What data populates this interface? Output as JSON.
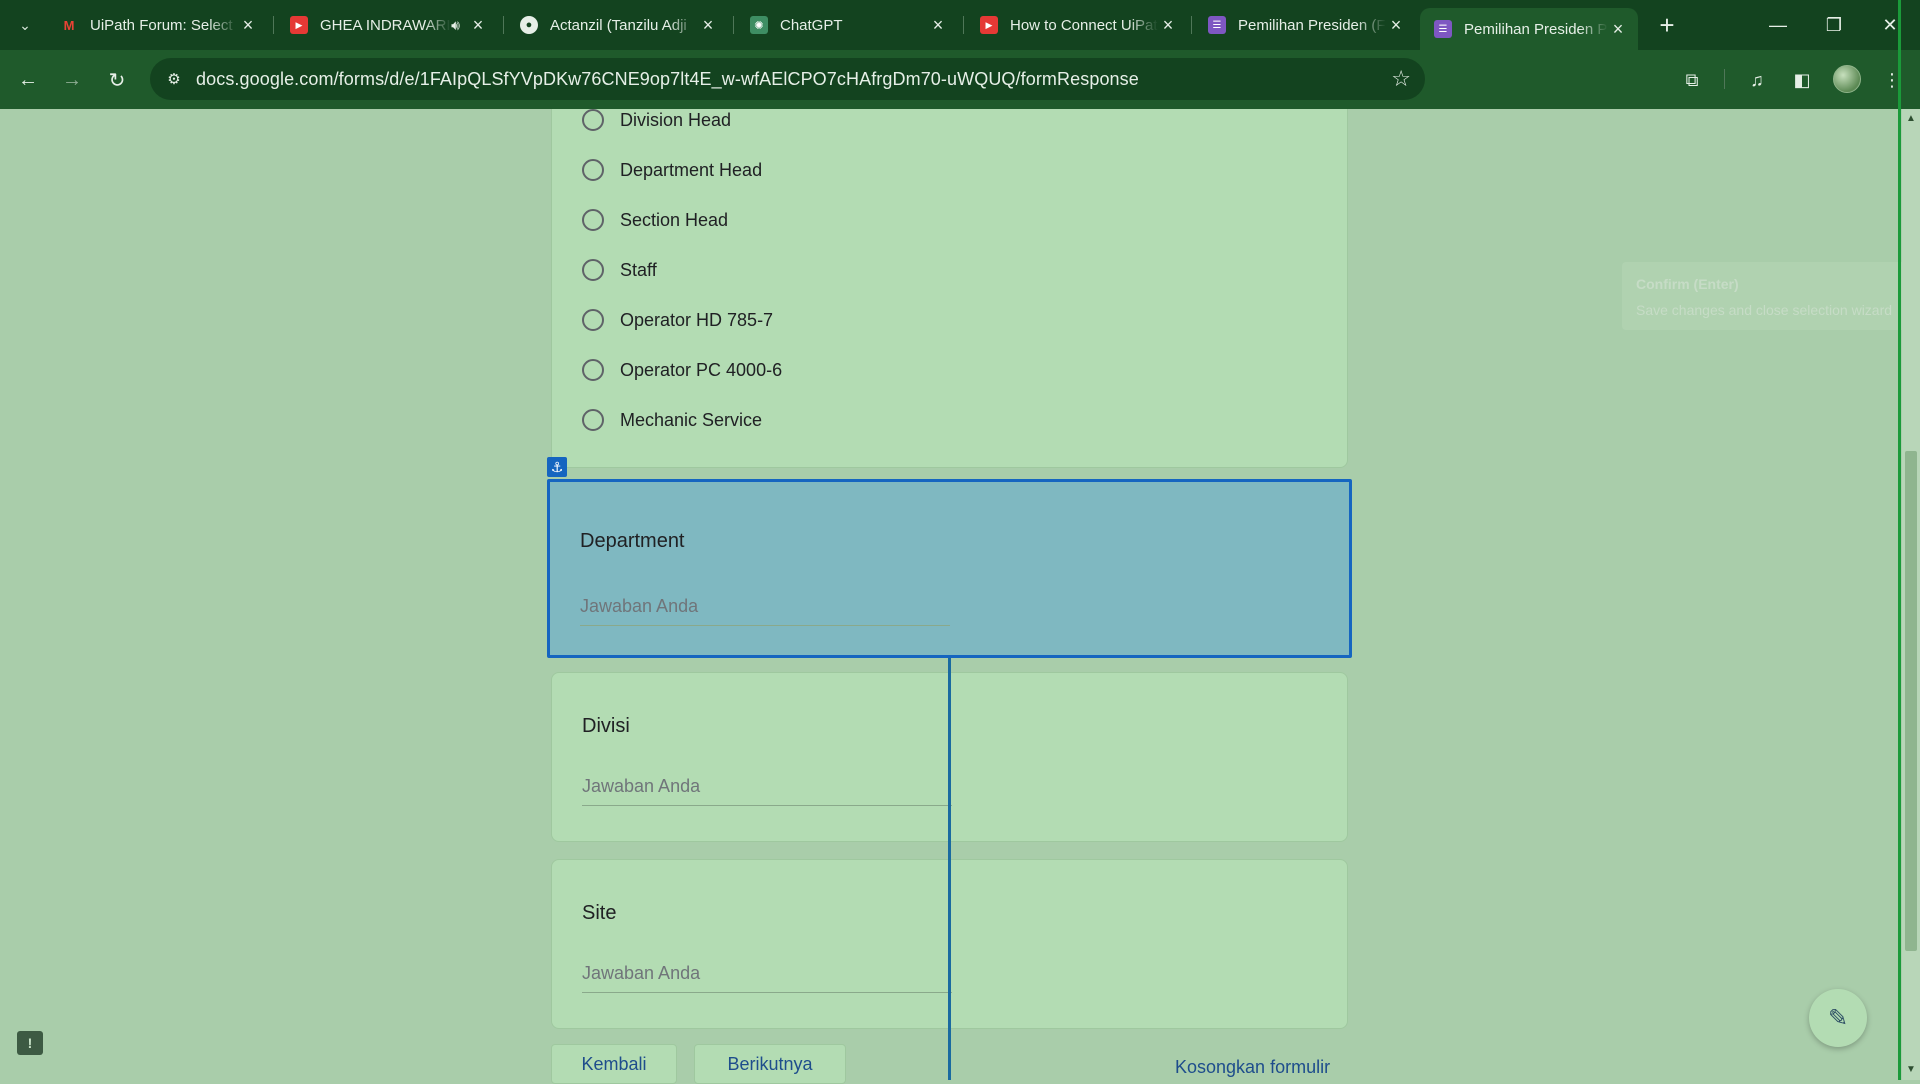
{
  "browser": {
    "tabs": [
      {
        "title": "UiPath Forum: Select",
        "favicon": "gmail-icon",
        "active": false
      },
      {
        "title": "GHEA INDRAWARI",
        "favicon": "youtube-icon",
        "active": false,
        "audio": true
      },
      {
        "title": "Actanzil (Tanzilu Adji",
        "favicon": "github-icon",
        "active": false
      },
      {
        "title": "ChatGPT",
        "favicon": "chatgpt-icon",
        "active": false
      },
      {
        "title": "How to Connect UiPath",
        "favicon": "youtube-icon",
        "active": false
      },
      {
        "title": "Pemilihan Presiden (F",
        "favicon": "google-forms-icon",
        "active": false
      },
      {
        "title": "Pemilihan Presiden P",
        "favicon": "google-forms-icon",
        "active": true
      }
    ],
    "url": "docs.google.com/forms/d/e/1FAIpQLSfYVpDKw76CNE9op7lt4E_w-wfAElCPO7cHAfrgDm70-uWQUQ/formResponse",
    "colors": {
      "frame": "#13431f",
      "toolbar": "#1f5a2b",
      "page_bg": "#a9cdaa",
      "card_bg": "#b3dcb3",
      "selection": "#1565c0"
    }
  },
  "form": {
    "job_options": [
      "Division Head",
      "Department Head",
      "Section Head",
      "Staff",
      "Operator HD 785-7",
      "Operator PC 4000-6",
      "Mechanic Service"
    ],
    "department": {
      "title": "Department",
      "placeholder": "Jawaban Anda"
    },
    "divisi": {
      "title": "Divisi",
      "placeholder": "Jawaban Anda"
    },
    "site": {
      "title": "Site",
      "placeholder": "Jawaban Anda"
    },
    "back_label": "Kembali",
    "next_label": "Berikutnya",
    "clear_label": "Kosongkan formulir"
  },
  "overlay": {
    "anchor_icon": "anchor-icon",
    "tooltip_title": "Confirm (Enter)",
    "tooltip_text": "Save changes and close selection wizard"
  }
}
